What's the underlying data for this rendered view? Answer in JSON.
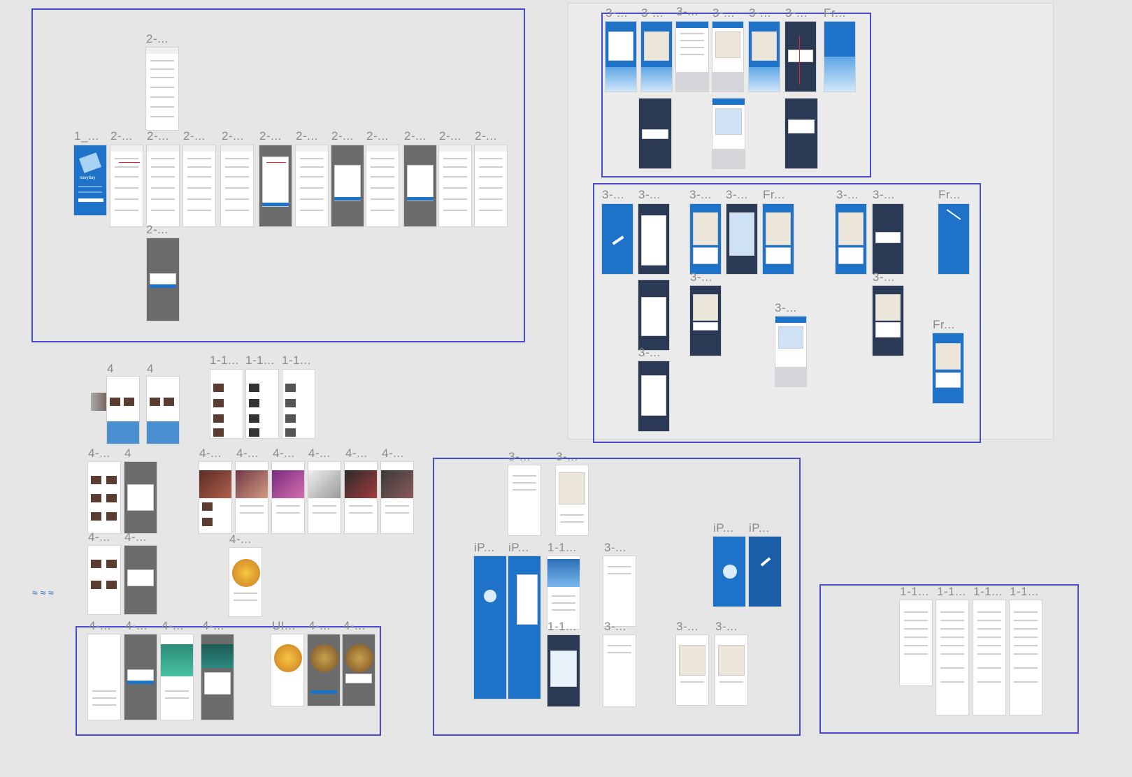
{
  "canvas": {
    "background": "#e6e6e6",
    "region_color": "#4a4ad0",
    "accent_blue": "#1e72c8"
  },
  "labels": {
    "top_single": "2-...",
    "onboarding": "1_...",
    "two_dash": "2-...",
    "three_dash": "3-...",
    "three_dash_short": "3-...",
    "frame": "Fr...",
    "four_dash": "4-...",
    "four": "4",
    "one_one": "1-1...",
    "iphone": "iP...",
    "ui": "UI..."
  },
  "annotations": {
    "app_name": "navybay"
  }
}
